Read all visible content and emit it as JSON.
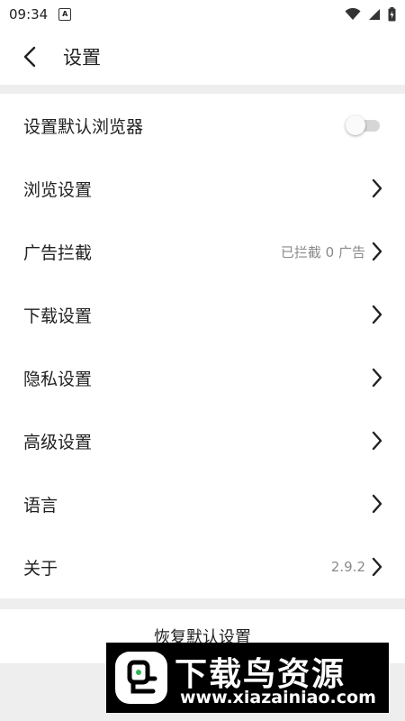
{
  "status_bar": {
    "time": "09:34",
    "notification_icon": "A"
  },
  "app_bar": {
    "title": "设置"
  },
  "settings": {
    "items": [
      {
        "label": "设置默认浏览器",
        "type": "toggle",
        "enabled": false
      },
      {
        "label": "浏览设置",
        "type": "nav"
      },
      {
        "label": "广告拦截",
        "type": "nav",
        "value": "已拦截 0 广告"
      },
      {
        "label": "下载设置",
        "type": "nav"
      },
      {
        "label": "隐私设置",
        "type": "nav"
      },
      {
        "label": "高级设置",
        "type": "nav"
      },
      {
        "label": "语言",
        "type": "nav"
      },
      {
        "label": "关于",
        "type": "nav",
        "value": "2.9.2"
      }
    ]
  },
  "restore_button": {
    "label": "恢复默认设置"
  },
  "watermark": {
    "title": "下载鸟资源",
    "url": "www.xiazainiao.com"
  },
  "colors": {
    "divider": "#eeeeee",
    "text": "#212121",
    "secondary_text": "#8a8a8a",
    "toggle_track": "#d6d6d6",
    "logo_green": "#2fb65a"
  }
}
